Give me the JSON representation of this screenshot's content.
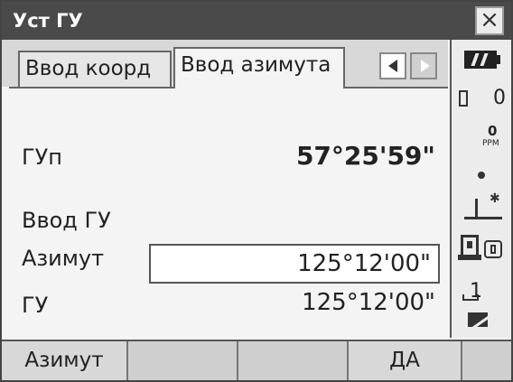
{
  "window": {
    "title": "Уст ГУ",
    "close_label": "×"
  },
  "tabs": [
    {
      "label": "Ввод коорд",
      "active": false
    },
    {
      "label": "Ввод азимута",
      "active": true
    }
  ],
  "fields": {
    "gup_label": "ГУп",
    "gup_value": "57°25'59\"",
    "section_label": "Ввод ГУ",
    "azimuth_label": "Азимут",
    "azimuth_input": "125°12'00\"",
    "gu_label": "ГУ",
    "gu_value": "125°12'00\""
  },
  "status": {
    "count": "0",
    "ppm_value": "0",
    "ppm_unit": "PPM",
    "face": "1",
    "icons": [
      "battery-icon",
      "memory-icon",
      "dot-icon",
      "prism-icon",
      "device-icon",
      "edit-icon"
    ]
  },
  "softkeys": [
    "Азимут",
    "",
    "",
    "ДА",
    ""
  ]
}
